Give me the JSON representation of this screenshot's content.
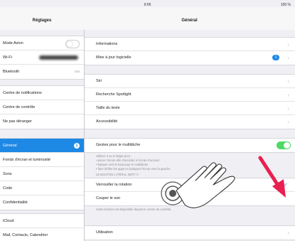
{
  "status": {
    "time": "9:06",
    "battery": "100 %"
  },
  "sidebar": {
    "title": "Réglages",
    "group1": [
      {
        "label": "Mode Avion",
        "toggle": "off"
      },
      {
        "label": "Wi-Fi"
      },
      {
        "label": "Bluetooth",
        "value": "Oui"
      }
    ],
    "group2": [
      {
        "label": "Centre de notifications"
      },
      {
        "label": "Centre de contrôle"
      },
      {
        "label": "Ne pas déranger"
      }
    ],
    "group3": [
      {
        "label": "Général",
        "badge": "1",
        "selected": true
      },
      {
        "label": "Fonds d'écran et luminosité"
      },
      {
        "label": "Sons"
      },
      {
        "label": "Code"
      },
      {
        "label": "Confidentialité"
      }
    ],
    "group4": [
      {
        "label": "iCloud"
      },
      {
        "label": "Mail, Contacts, Calendrier"
      }
    ]
  },
  "main": {
    "title": "Général",
    "group1": [
      {
        "label": "Informations"
      },
      {
        "label": "Mise à jour logicielle",
        "badge": "1"
      }
    ],
    "group2": [
      {
        "label": "Siri"
      },
      {
        "label": "Recherche Spotlight"
      },
      {
        "label": "Taille du texte"
      },
      {
        "label": "Accessibilité"
      }
    ],
    "multitask": {
      "label": "Gestes pour le multitâche",
      "toggle": "on"
    },
    "footer1": "Utilisez 4 ou 5 doigts pour :\n• pincer l'écran afin d'accéder à l'écran d'accueil\n• balayer vers le haut pour le multitâche\n• faire défiler les apps en balayant l'écran vers la gauche",
    "side_switch_header": "LE BOUTON LATÉRAL SERT À :",
    "group4": [
      {
        "label": "Verrouiller la rotation",
        "checked": true
      },
      {
        "label": "Couper le son"
      }
    ],
    "footer2": "Cette fonction est disponible depuis le centre de contrôle.",
    "group5": [
      {
        "label": "Utilisation"
      }
    ]
  },
  "colors": {
    "accent": "#1e88e5",
    "toggle_on": "#4cd964",
    "arrow": "#e8204f"
  },
  "icons": {
    "hand": "tap-hand-icon",
    "arrow": "pink-arrow-icon"
  }
}
